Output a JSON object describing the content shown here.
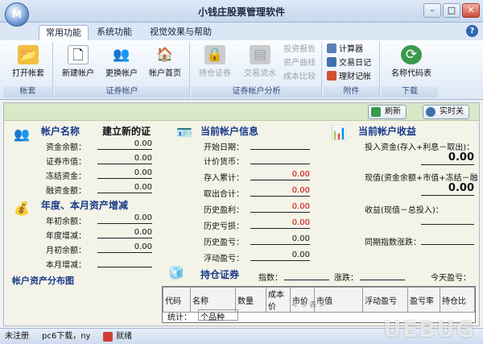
{
  "window": {
    "title": "小钱庄股票管理软件",
    "orb_label": "M"
  },
  "tabs": [
    "常用功能",
    "系统功能",
    "视觉效果与帮助"
  ],
  "ribbon": {
    "groups": [
      "帐套",
      "证券帐户",
      "证券帐户分析",
      "附件",
      "下载"
    ],
    "open_account_set": "打开帐套",
    "new_account": "新建帐户",
    "switch_account": "更换帐户",
    "account_home": "帐户首页",
    "position_securities": "持仓证券",
    "transaction_flow": "交易流水",
    "investment_report": "投资报告",
    "asset_curve": "资产曲线",
    "cost_comparison": "成本比较",
    "calculator": "计算器",
    "trade_diary": "交易日记",
    "finance_notes": "理财记帐",
    "name_code_table": "名称代码表"
  },
  "toolbar": {
    "refresh": "刷新",
    "realtime_off": "实时关"
  },
  "account": {
    "title": "帐户名称",
    "name": "建立新的证",
    "fields": [
      {
        "label": "资金余额：",
        "value": "0.00"
      },
      {
        "label": "证券市值：",
        "value": "0.00"
      },
      {
        "label": "冻结资金：",
        "value": "0.00"
      },
      {
        "label": "融资金额：",
        "value": "0.00"
      }
    ]
  },
  "yearmonth": {
    "title": "年度、本月资产增减",
    "fields": [
      {
        "label": "年初余额：",
        "value": "0.00"
      },
      {
        "label": "年度增减：",
        "value": "0.00"
      },
      {
        "label": "月初余额：",
        "value": "0.00"
      },
      {
        "label": "本月增减：",
        "value": ""
      }
    ]
  },
  "distribution_title": "帐户资产分布图",
  "current_info": {
    "title": "当前帐户信息",
    "fields": [
      {
        "label": "开始日期：",
        "value": "",
        "red": false
      },
      {
        "label": "计价货币：",
        "value": "",
        "red": false
      },
      {
        "label": "存入累计：",
        "value": "0.00",
        "red": true
      },
      {
        "label": "取出合计：",
        "value": "0.00",
        "red": true
      },
      {
        "label": "历史盈利：",
        "value": "0.00",
        "red": true
      },
      {
        "label": "历史亏损：",
        "value": "0.00",
        "red": true
      },
      {
        "label": "历史盈亏：",
        "value": "0.00",
        "red": false
      },
      {
        "label": "浮动盈亏：",
        "value": "0.00",
        "red": false
      }
    ]
  },
  "current_profit": {
    "title": "当前帐户收益",
    "invest_label": "投入资金(存入+利息－取出)：",
    "invest_value": "0.00",
    "present_label": "现值(资金余额+市值+冻结－融",
    "present_value": "0.00",
    "profit_label": "收益(现值－总投入)：",
    "profit_value": "",
    "index_label": "同期指数涨跌：",
    "index_value": ""
  },
  "positions": {
    "title": "持仓证券",
    "index_label": "指数：",
    "change_label": "涨跌：",
    "today_label": "今天盈亏：",
    "columns": [
      "代码",
      "名称",
      "数量",
      "成本价",
      "市价",
      "市值",
      "浮动盈亏",
      "盈亏率",
      "持仓比"
    ],
    "scroll_hint": "< 今 表 >",
    "summary_label": "统计：",
    "summary_kinds": "个品种"
  },
  "status": {
    "user": "未注册",
    "source": "pc6下载，ny",
    "state": "就绪"
  },
  "watermark": "UEBUG"
}
